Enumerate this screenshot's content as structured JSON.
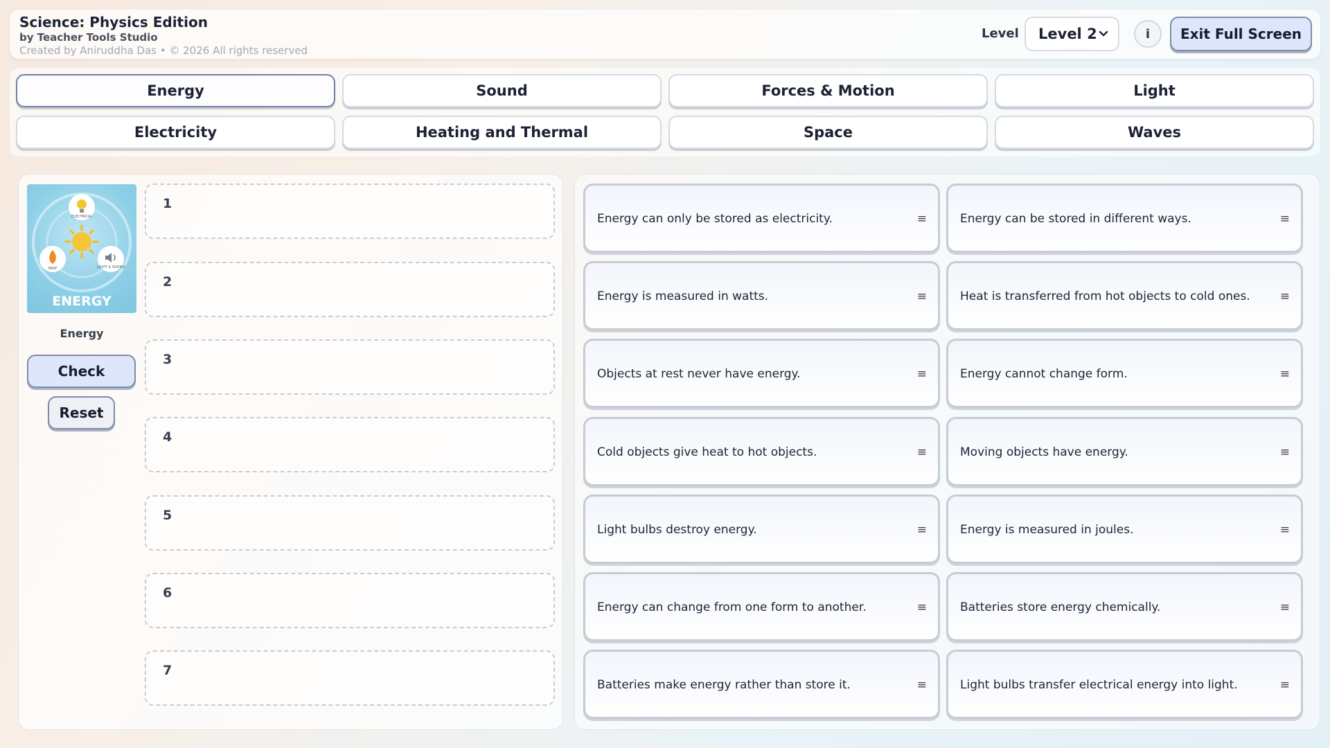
{
  "header": {
    "title": "Science: Physics Edition",
    "subtitle": "by Teacher Tools Studio",
    "credit": "Created by Aniruddha Das • © 2026 All rights reserved",
    "level_label": "Level",
    "level_value": "Level 2",
    "info_label": "i",
    "exit_label": "Exit Full Screen"
  },
  "topics": [
    {
      "label": "Energy",
      "active": true
    },
    {
      "label": "Sound"
    },
    {
      "label": "Forces & Motion"
    },
    {
      "label": "Light"
    },
    {
      "label": "Electricity"
    },
    {
      "label": "Heating and Thermal"
    },
    {
      "label": "Space"
    },
    {
      "label": "Waves"
    }
  ],
  "left": {
    "image_title": "ENERGY",
    "image_badges": [
      "ELECTRICAL",
      "HEAT",
      "LIGHT & SOUND"
    ],
    "image_label": "Energy",
    "check_label": "Check",
    "reset_label": "Reset",
    "slots": [
      "1",
      "2",
      "3",
      "4",
      "5",
      "6",
      "7"
    ]
  },
  "cards": [
    "Energy can only be stored as electricity.",
    "Energy can be stored in different ways.",
    "Energy is measured in watts.",
    "Heat is transferred from hot objects to cold ones.",
    "Objects at rest never have energy.",
    "Energy cannot change form.",
    "Cold objects give heat to hot objects.",
    "Moving objects have energy.",
    "Light bulbs destroy energy.",
    "Energy is measured in joules.",
    "Energy can change from one form to another.",
    "Batteries store energy chemically.",
    "Batteries make energy rather than store it.",
    "Light bulbs transfer electrical energy into light."
  ],
  "card_handle": "≡"
}
